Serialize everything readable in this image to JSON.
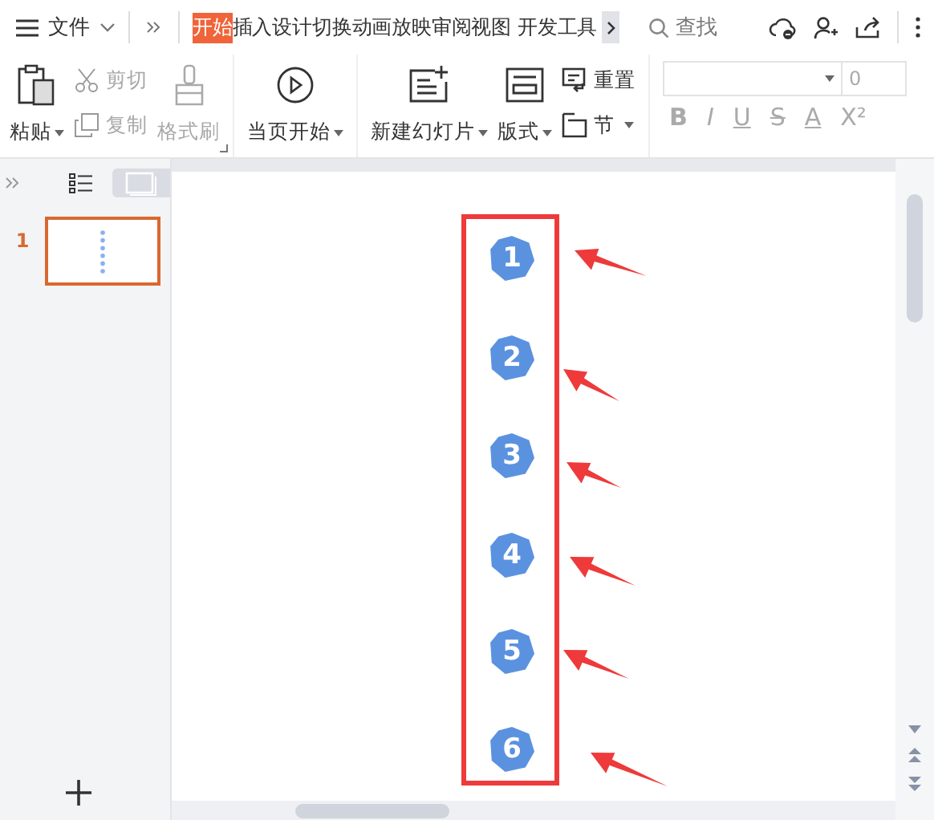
{
  "menu": {
    "label": "文件"
  },
  "tabs": [
    {
      "label": "开始",
      "selected": true
    },
    {
      "label": "插入",
      "selected": false
    },
    {
      "label": "设计",
      "selected": false
    },
    {
      "label": "切换",
      "selected": false
    },
    {
      "label": "动画",
      "selected": false
    },
    {
      "label": "放映",
      "selected": false
    },
    {
      "label": "审阅",
      "selected": false
    },
    {
      "label": "视图",
      "selected": false
    },
    {
      "label": "开发工具",
      "selected": false
    }
  ],
  "search": {
    "placeholder": "查找"
  },
  "clipboard": {
    "paste": {
      "label": "粘贴",
      "disabled": false
    },
    "cut": {
      "label": "剪切",
      "disabled": true
    },
    "copy": {
      "label": "复制",
      "disabled": true
    },
    "format_painter": {
      "label": "格式刷",
      "disabled": true
    }
  },
  "play": {
    "label": "当页开始"
  },
  "slides_group": {
    "new_slide": {
      "label": "新建幻灯片"
    },
    "layout": {
      "label": "版式"
    },
    "reset": {
      "label": "重置"
    },
    "section": {
      "label": "节"
    }
  },
  "font": {
    "size": "0",
    "buttons": [
      "B",
      "I",
      "U",
      "S",
      "A",
      "X²"
    ]
  },
  "slide_panel": {
    "slides": [
      {
        "number": "1",
        "selected": true
      }
    ]
  },
  "markers": [
    {
      "label": "1"
    },
    {
      "label": "2"
    },
    {
      "label": "3"
    },
    {
      "label": "4"
    },
    {
      "label": "5"
    },
    {
      "label": "6"
    }
  ]
}
